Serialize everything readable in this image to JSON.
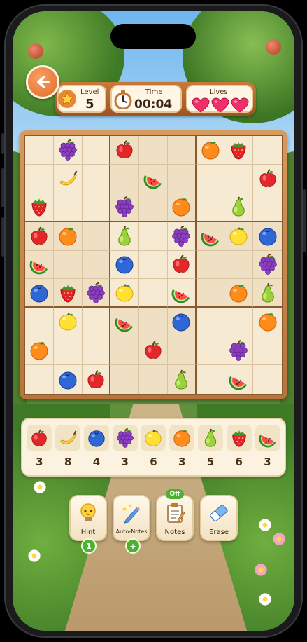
{
  "hud": {
    "level_label": "Level",
    "level_value": "5",
    "time_label": "Time",
    "time_value": "00:04",
    "lives_label": "Lives",
    "lives_count": 3
  },
  "board": {
    "rows": [
      [
        "",
        "grape",
        "",
        "apple",
        "",
        "",
        "orange",
        "strawberry",
        ""
      ],
      [
        "",
        "banana",
        "",
        "",
        "watermelon",
        "",
        "",
        "",
        "apple"
      ],
      [
        "strawberry",
        "",
        "",
        "grape",
        "",
        "orange",
        "",
        "pear",
        ""
      ],
      [
        "apple",
        "orange",
        "",
        "pear",
        "",
        "grape",
        "watermelon",
        "lemon",
        "blueberry"
      ],
      [
        "watermelon",
        "",
        "",
        "blueberry",
        "",
        "apple",
        "",
        "",
        "grape"
      ],
      [
        "blueberry",
        "strawberry",
        "grape",
        "lemon",
        "",
        "watermelon",
        "",
        "orange",
        "pear"
      ],
      [
        "",
        "lemon",
        "",
        "watermelon",
        "",
        "blueberry",
        "",
        "",
        "orange"
      ],
      [
        "orange",
        "",
        "",
        "",
        "apple",
        "",
        "",
        "grape",
        ""
      ],
      [
        "",
        "blueberry",
        "apple",
        "",
        "",
        "pear",
        "",
        "watermelon",
        ""
      ]
    ]
  },
  "fruit_counts": [
    {
      "fruit": "apple",
      "count": "3"
    },
    {
      "fruit": "banana",
      "count": "8"
    },
    {
      "fruit": "blueberry",
      "count": "4"
    },
    {
      "fruit": "grape",
      "count": "3"
    },
    {
      "fruit": "lemon",
      "count": "6"
    },
    {
      "fruit": "orange",
      "count": "3"
    },
    {
      "fruit": "pear",
      "count": "5"
    },
    {
      "fruit": "strawberry",
      "count": "6"
    },
    {
      "fruit": "watermelon",
      "count": "3"
    }
  ],
  "tools": {
    "hint_label": "Hint",
    "hint_badge": "1",
    "autonotes_label": "Auto-Notes",
    "autonotes_badge": "+",
    "notes_label": "Notes",
    "notes_badge": "Off",
    "erase_label": "Erase"
  },
  "colors": {
    "board_frame": "#c8864a",
    "cell_bg": "#f6ead2",
    "accent_green": "#4fb035",
    "back_button": "#e8773a"
  }
}
